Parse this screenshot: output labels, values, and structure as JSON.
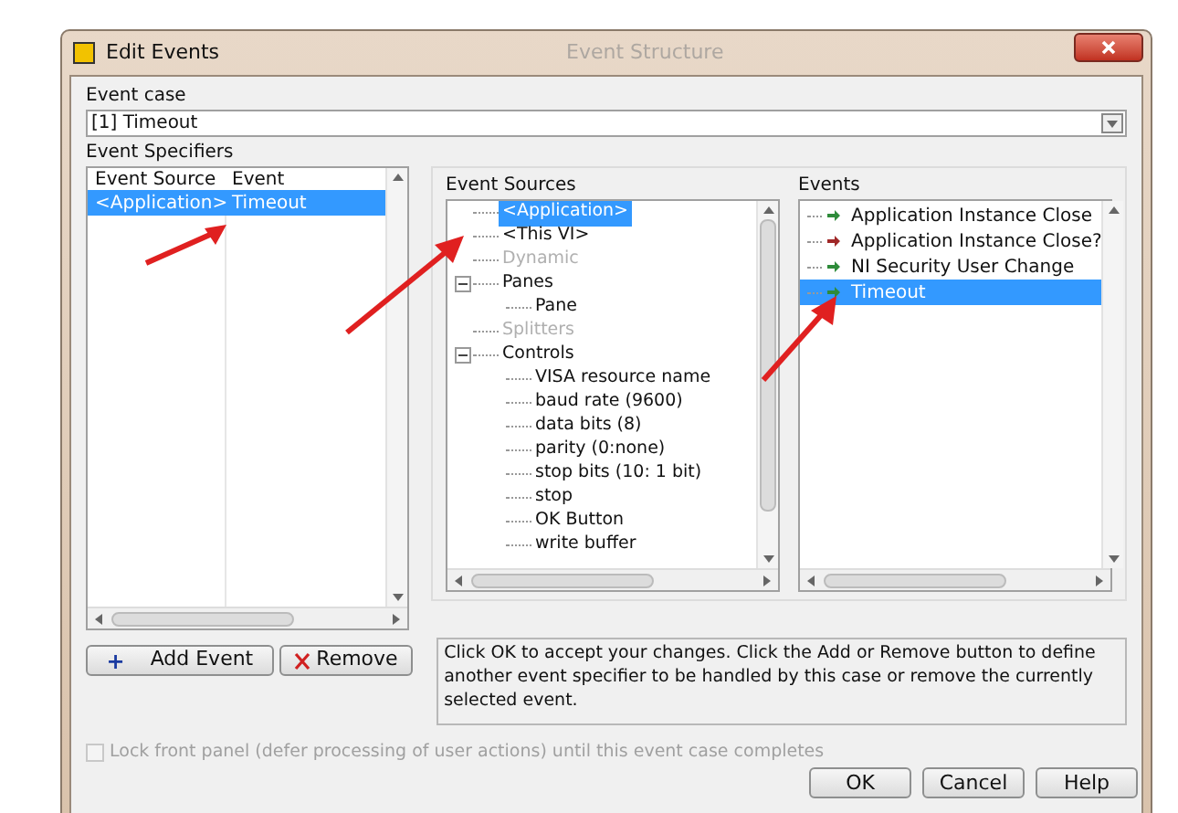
{
  "background_title": "Event Structure",
  "window": {
    "title": "Edit Events"
  },
  "event_case": {
    "label": "Event case",
    "value": "[1] Timeout"
  },
  "event_specifiers": {
    "label": "Event Specifiers",
    "columns": [
      "Event Source",
      "Event"
    ],
    "rows": [
      {
        "source": "<Application>",
        "event": "Timeout",
        "selected": true
      }
    ]
  },
  "event_sources": {
    "label": "Event Sources",
    "items": [
      {
        "label": "<Application>",
        "selected": true,
        "disabled": false
      },
      {
        "label": "<This VI>",
        "selected": false,
        "disabled": false
      },
      {
        "label": "Dynamic",
        "selected": false,
        "disabled": true
      },
      {
        "label": "Panes",
        "selected": false,
        "disabled": false,
        "expanded": true,
        "children": [
          {
            "label": "Pane",
            "selected": false,
            "disabled": false
          }
        ]
      },
      {
        "label": "Splitters",
        "selected": false,
        "disabled": true
      },
      {
        "label": "Controls",
        "selected": false,
        "disabled": false,
        "expanded": true,
        "children": [
          {
            "label": "VISA resource name",
            "selected": false,
            "disabled": false
          },
          {
            "label": "baud rate (9600)",
            "selected": false,
            "disabled": false
          },
          {
            "label": "data bits (8)",
            "selected": false,
            "disabled": false
          },
          {
            "label": "parity (0:none)",
            "selected": false,
            "disabled": false
          },
          {
            "label": "stop bits (10: 1 bit)",
            "selected": false,
            "disabled": false
          },
          {
            "label": "stop",
            "selected": false,
            "disabled": false
          },
          {
            "label": "OK Button",
            "selected": false,
            "disabled": false
          },
          {
            "label": "write buffer",
            "selected": false,
            "disabled": false
          }
        ]
      }
    ]
  },
  "events": {
    "label": "Events",
    "items": [
      {
        "label": "Application Instance Close",
        "selected": false,
        "color": "#2e8b3a"
      },
      {
        "label": "Application Instance Close?",
        "selected": false,
        "color": "#a02828"
      },
      {
        "label": "NI Security User Change",
        "selected": false,
        "color": "#2e8b3a"
      },
      {
        "label": "Timeout",
        "selected": true,
        "color": "#2e8b3a"
      }
    ]
  },
  "buttons": {
    "add": {
      "icon": "+",
      "label": "Add Event"
    },
    "remove": {
      "label": "Remove"
    }
  },
  "help_text": "Click OK to accept your changes.  Click the Add or Remove button to define another event specifier to be handled by this case or remove the currently selected event.",
  "lock_front_panel": {
    "label": "Lock front panel (defer processing of user actions) until this event case completes",
    "checked": false,
    "disabled": true
  },
  "dialog_buttons": [
    "OK",
    "Cancel",
    "Help"
  ]
}
